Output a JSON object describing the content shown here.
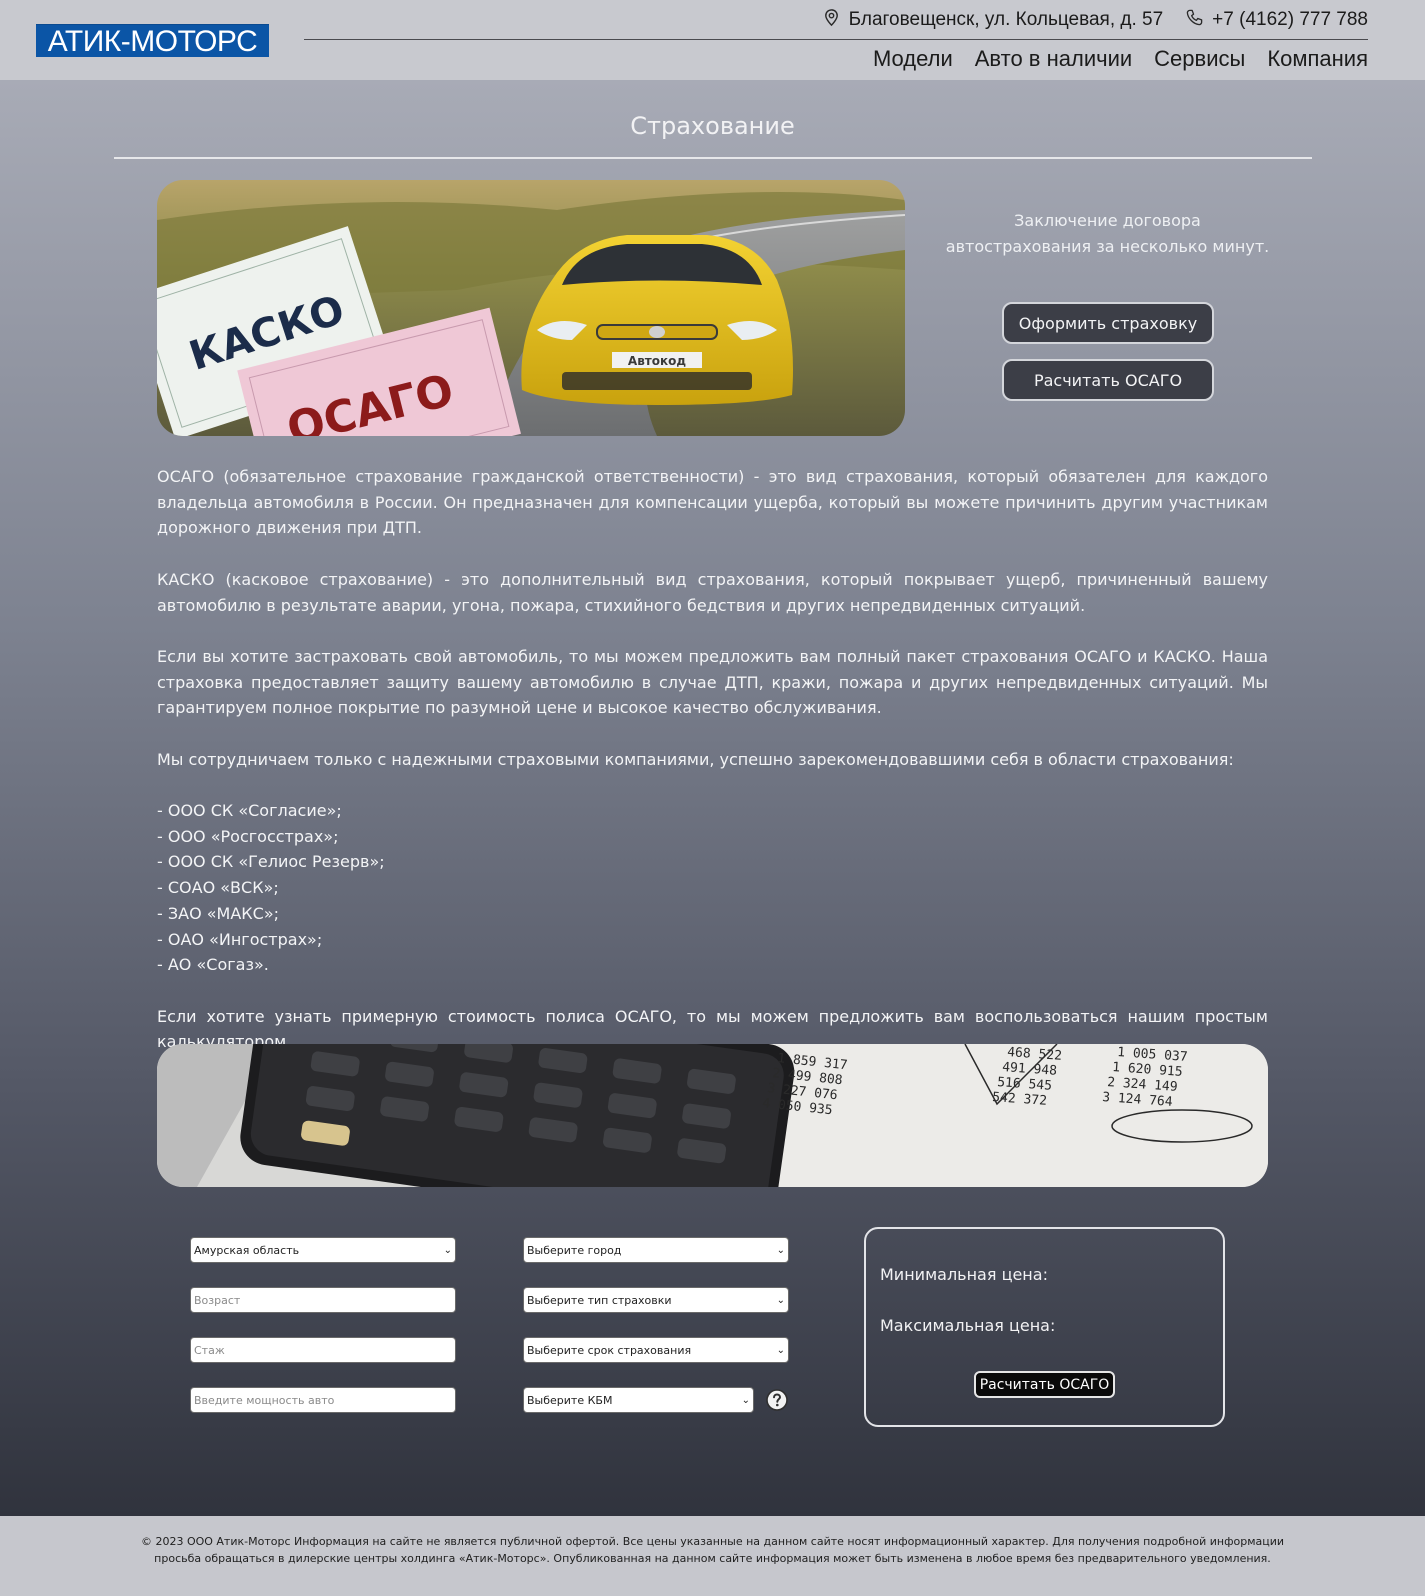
{
  "header": {
    "logo": "АТИК-МОТОРС",
    "address": "Благовещенск, ул. Кольцевая, д. 57",
    "phone": "+7 (4162) 777 788",
    "nav": [
      "Модели",
      "Авто в наличии",
      "Сервисы",
      "Компания"
    ]
  },
  "page": {
    "title": "Страхование",
    "hero_text": "Заключение договора автострахования за несколько минут.",
    "btn_apply": "Оформить страховку",
    "btn_calc": "Расчитать ОСАГО",
    "hero_image": {
      "kasko": "КАСКО",
      "osago": "ОСАГО",
      "plate": "Автокод"
    }
  },
  "content": {
    "p1": "ОСАГО (обязательное страхование гражданской ответственности) - это вид страхования, который обязателен для каждого владельца автомобиля в России. Он предназначен для компенсации ущерба, который вы можете причинить другим участникам дорожного движения при ДТП.",
    "p2": "КАСКО (касковое страхование) - это дополнительный вид страхования, который покрывает ущерб, причиненный вашему автомобилю в результате аварии, угона, пожара, стихийного бедствия и других непредвиденных ситуаций.",
    "p3": "Если вы хотите застраховать свой автомобиль, то мы можем предложить вам полный пакет страхования ОСАГО и КАСКО. Наша страховка предоставляет защиту вашему автомобилю в случае ДТП, кражи, пожара и других непредвиденных ситуаций. Мы гарантируем полное покрытие по разумной цене и высокое качество обслуживания.",
    "p4": "Мы сотрудничаем только с надежными страховыми компаниями, успешно зарекомендовавшими себя в области страхования:",
    "companies": [
      "- ООО СК «Согласие»;",
      "- ООО «Росгосстрах»;",
      "- ООО СК «Гелиос Резерв»;",
      "- СОАО «ВСК»;",
      "- ЗАО «МАКС»;",
      "- ОАО «Ингострах»;",
      "- АО «Согаз»."
    ],
    "p5": "Если хотите узнать примерную стоимость полиса ОСАГО, то мы можем предложить вам воспользоваться нашим простым калькулятором."
  },
  "form": {
    "region": "Амурская область",
    "age_placeholder": "Возраст",
    "experience_placeholder": "Стаж",
    "power_placeholder": "Введите мощность авто",
    "city": "Выберите город",
    "insurance_type": "Выберите тип страховки",
    "term": "Выберите срок страхования",
    "kbm": "Выберите КБМ"
  },
  "result": {
    "min_label": "Минимальная цена:",
    "max_label": "Максимальная цена:",
    "calc_button": "Расчитать ОСАГО"
  },
  "footer": {
    "text": "© 2023 ООО Атик-Моторс Информация на сайте не является публичной офертой. Все цены указанные на данном сайте носят информационный характер. Для получения подробной информации просьба обращаться в дилерские центры холдинга «Атик-Моторс». Опубликованная на данном сайте информация может быть изменена в любое время без предварительного уведомления."
  },
  "colors": {
    "logo_bg": "#0b55a6",
    "header_bg": "#c8c9cf",
    "button_dark": "#3c3e47"
  }
}
